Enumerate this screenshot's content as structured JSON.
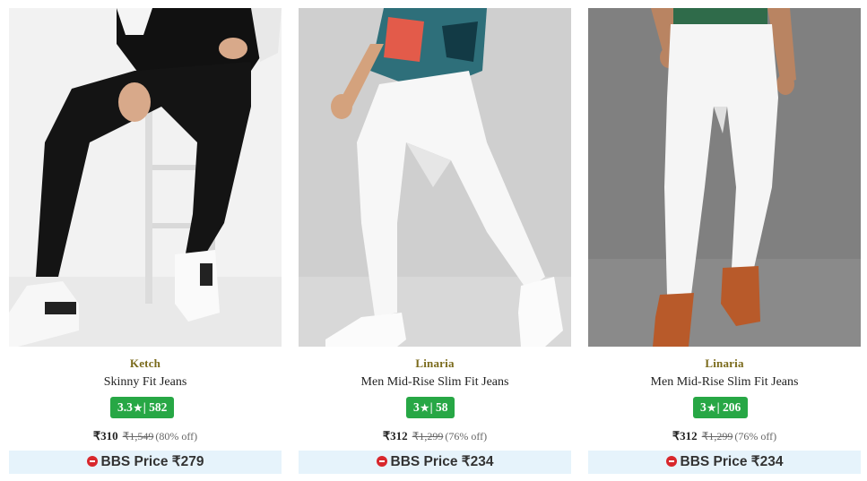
{
  "products": [
    {
      "brand": "Ketch",
      "title": "Skinny Fit Jeans",
      "rating": "3.3",
      "reviews": "582",
      "price": "₹310",
      "mrp": "₹1,549",
      "discount": "(80% off)",
      "bbs_price": "BBS Price ₹279",
      "image_icon": "black-jeans-photo"
    },
    {
      "brand": "Linaria",
      "title": "Men Mid-Rise Slim Fit Jeans",
      "rating": "3",
      "reviews": "58",
      "price": "₹312",
      "mrp": "₹1,299",
      "discount": "(76% off)",
      "bbs_price": "BBS Price ₹234",
      "image_icon": "white-jeans-photo"
    },
    {
      "brand": "Linaria",
      "title": "Men Mid-Rise Slim Fit Jeans",
      "rating": "3",
      "reviews": "206",
      "price": "₹312",
      "mrp": "₹1,299",
      "discount": "(76% off)",
      "bbs_price": "BBS Price ₹234",
      "image_icon": "white-jeans-photo"
    }
  ],
  "separator": "|",
  "star_glyph": "★",
  "colors": {
    "brand": "#7a6a1b",
    "rating_badge": "#27a745",
    "bbs_background": "#e6f3fb",
    "bbs_icon": "#d8272c"
  }
}
